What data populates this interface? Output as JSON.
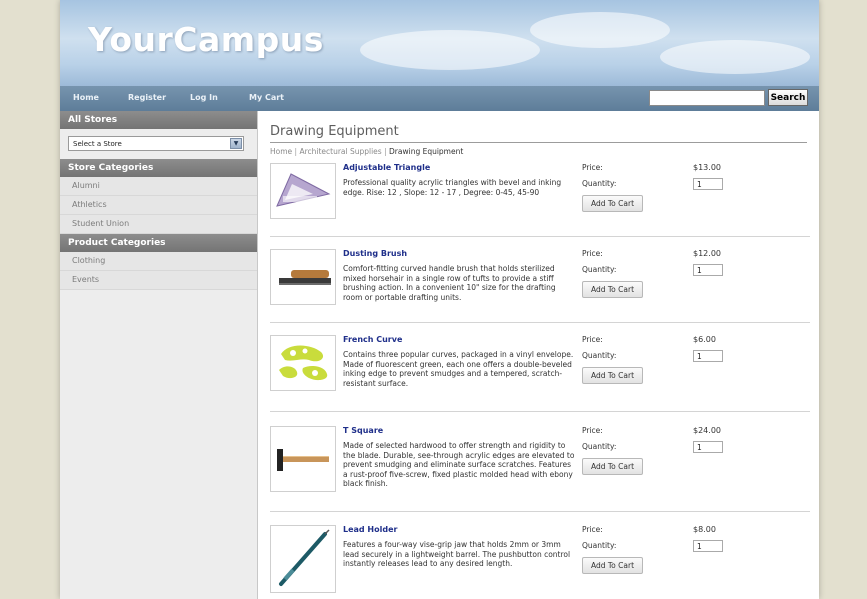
{
  "header": {
    "logo": "YourCampus",
    "nav": [
      "Home",
      "Register",
      "Log In",
      "My Cart"
    ],
    "search_button": "Search",
    "search_value": ""
  },
  "sidebar": {
    "all_stores_heading": "All Stores",
    "store_select": "Select a Store",
    "store_categories_heading": "Store Categories",
    "store_categories": [
      "Alumni",
      "Athletics",
      "Student Union"
    ],
    "product_categories_heading": "Product Categories",
    "product_categories": [
      "Clothing",
      "Events"
    ]
  },
  "main": {
    "title": "Drawing Equipment",
    "breadcrumb": {
      "home": "Home",
      "sep": " | ",
      "parent": "Architectural Supplies",
      "current": "Drawing Equipment"
    },
    "price_label": "Price:",
    "quantity_label": "Quantity:",
    "add_to_cart_label": "Add To Cart",
    "products": [
      {
        "name": "Adjustable Triangle",
        "description": "Professional quality acrylic triangles with bevel and inking edge. Rise: 12 , Slope: 12 - 17 , Degree: 0-45, 45-90",
        "price": "$13.00",
        "quantity": "1",
        "icon": "triangle-icon"
      },
      {
        "name": "Dusting Brush",
        "description": "Comfort-fitting curved handle brush that holds sterilized mixed horsehair in a single row of tufts to provide a stiff brushing action. In a convenient 10\" size for the drafting room or portable drafting units.",
        "price": "$12.00",
        "quantity": "1",
        "icon": "brush-icon"
      },
      {
        "name": "French Curve",
        "description": "Contains three popular curves, packaged in a vinyl envelope. Made of fluorescent green, each one offers a double-beveled inking edge to prevent smudges and a tempered, scratch-resistant surface.",
        "price": "$6.00",
        "quantity": "1",
        "icon": "french-curve-icon"
      },
      {
        "name": "T Square",
        "description": "Made of selected hardwood to offer strength and rigidity to the blade. Durable, see-through acrylic edges are elevated to prevent smudging and eliminate surface scratches. Features a rust-proof five-screw, fixed plastic molded head with ebony black finish.",
        "price": "$24.00",
        "quantity": "1",
        "icon": "t-square-icon"
      },
      {
        "name": "Lead Holder",
        "description": "Features a four-way vise-grip jaw that holds 2mm or 3mm lead securely in a lightweight barrel. The pushbutton control instantly releases lead to any desired length.",
        "price": "$8.00",
        "quantity": "1",
        "icon": "lead-holder-icon"
      }
    ]
  }
}
